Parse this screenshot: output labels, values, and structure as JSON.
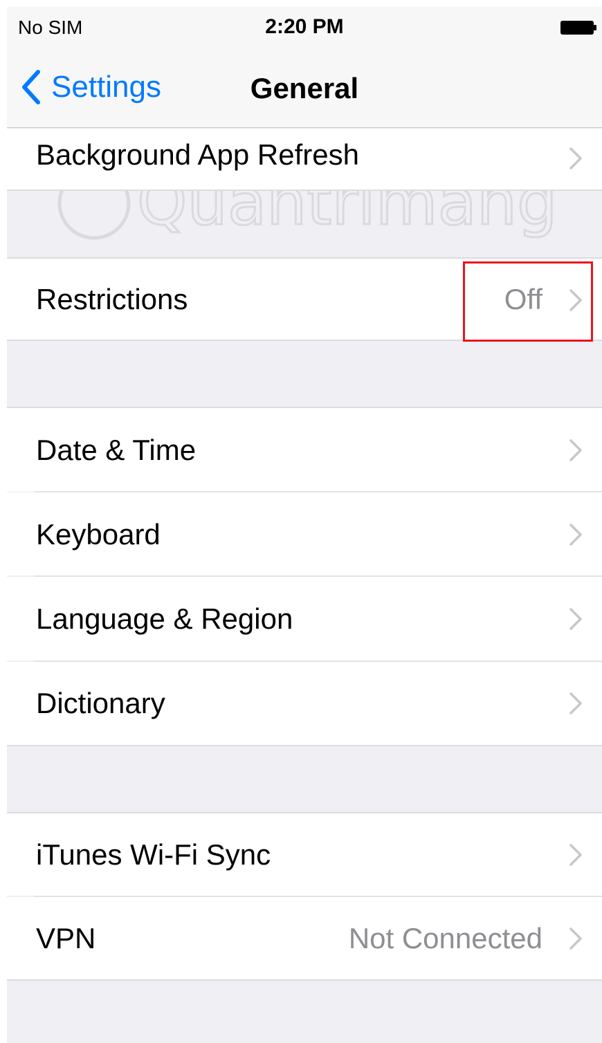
{
  "status_bar": {
    "carrier": "No SIM",
    "time": "2:20 PM"
  },
  "nav": {
    "back_label": "Settings",
    "title": "General"
  },
  "rows": {
    "background_app_refresh": {
      "label": "Background App Refresh"
    },
    "restrictions": {
      "label": "Restrictions",
      "detail": "Off"
    },
    "date_time": {
      "label": "Date & Time"
    },
    "keyboard": {
      "label": "Keyboard"
    },
    "language_region": {
      "label": "Language & Region"
    },
    "dictionary": {
      "label": "Dictionary"
    },
    "itunes_wifi_sync": {
      "label": "iTunes Wi-Fi Sync"
    },
    "vpn": {
      "label": "VPN",
      "detail": "Not Connected"
    }
  },
  "watermark_text": "Quantrimang",
  "colors": {
    "accent": "#007aff",
    "detail_text": "#8e8e93",
    "grouped_background": "#efeff4",
    "highlight_box": "#e8141e"
  },
  "icons": {
    "back": "chevron-left-icon",
    "row_disclosure": "chevron-right-icon",
    "battery": "battery-icon"
  }
}
